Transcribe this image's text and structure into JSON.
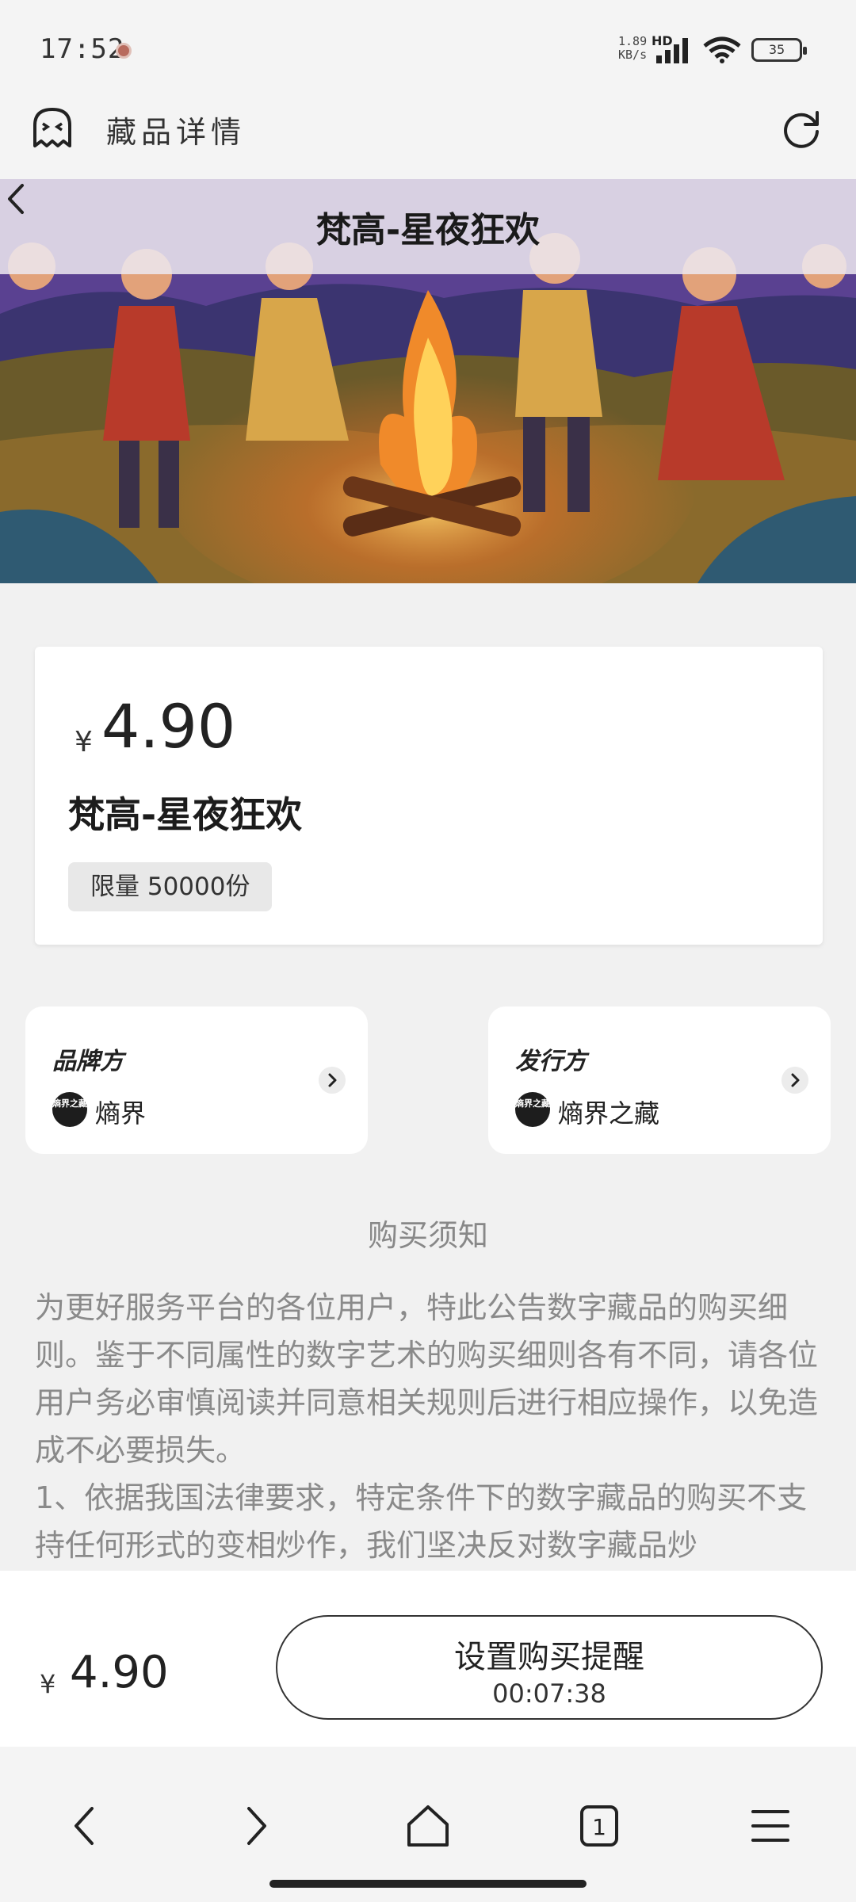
{
  "status_bar": {
    "time": "17:52",
    "net_speed_value": "1.89",
    "net_speed_unit": "KB/s",
    "network_label": "HD",
    "battery": "35"
  },
  "app_header": {
    "title": "藏品详情"
  },
  "hero": {
    "title": "梵高-星夜狂欢"
  },
  "product": {
    "currency": "¥",
    "price": "4.90",
    "name": "梵高-星夜狂欢",
    "limit": "限量 50000份"
  },
  "brand": {
    "label": "品牌方",
    "name": "熵界",
    "logo_text": "熵界之藏"
  },
  "publisher": {
    "label": "发行方",
    "name": "熵界之藏",
    "logo_text": "熵界之藏"
  },
  "notice": {
    "title": "购买须知",
    "body": "为更好服务平台的各位用户，特此公告数字藏品的购买细则。鉴于不同属性的数字艺术的购买细则各有不同，请各位用户务必审慎阅读并同意相关规则后进行相应操作，以免造成不必要损失。\n1、依据我国法律要求，特定条件下的数字藏品的购买不支持任何形式的变相炒作，我们坚决反对数字藏品炒"
  },
  "buy_bar": {
    "currency": "¥",
    "price": "4.90",
    "remind_label": "设置购买提醒",
    "countdown": "00:07:38"
  },
  "browser_nav": {
    "tab_count": "1"
  }
}
